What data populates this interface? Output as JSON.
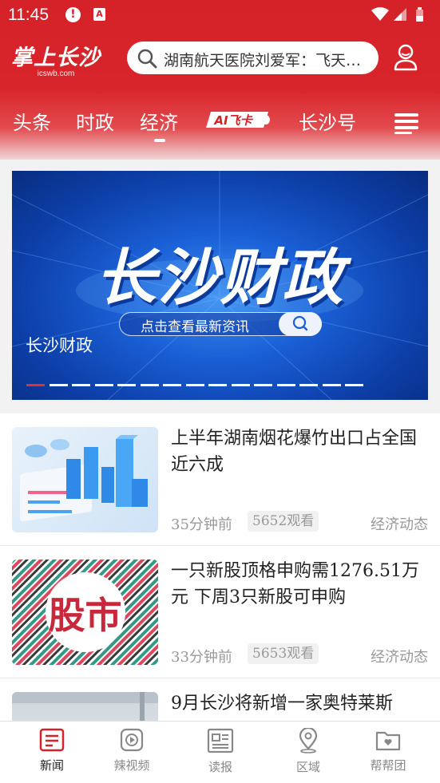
{
  "status_bar": {
    "time": "11:45",
    "icon_alert": "!",
    "icon_a": "A"
  },
  "header": {
    "logo_text": "掌上长沙",
    "logo_domain": "icswb.com",
    "search_text": "湖南航天医院刘爱军：飞天护航",
    "tabs": [
      "头条",
      "时政",
      "经济",
      "长沙号"
    ],
    "active_tab": "经济",
    "ai_tab_label": "AI飞卡"
  },
  "banner": {
    "title": "长沙财政",
    "search_label": "点击查看最新资讯",
    "caption": "长沙财政",
    "dot_count": 15,
    "active_dot": 0
  },
  "feed": [
    {
      "title": "上半年湖南烟花爆竹出口占全国近六成",
      "time": "35分钟前",
      "views": "5652观看",
      "category": "经济动态"
    },
    {
      "title": "一只新股顶格申购需1276.51万元  下周3只新股可申购",
      "time": "33分钟前",
      "views": "5653观看",
      "category": "经济动态",
      "thumb_text": "股市"
    },
    {
      "title": "9月长沙将新增一家奥特莱斯"
    }
  ],
  "bottom_nav": [
    {
      "label": "新闻",
      "icon": "news-icon",
      "active": true
    },
    {
      "label": "辣视频",
      "icon": "video-icon",
      "active": false
    },
    {
      "label": "读报",
      "icon": "newspaper-icon",
      "active": false
    },
    {
      "label": "区域",
      "icon": "location-icon",
      "active": false
    },
    {
      "label": "帮帮团",
      "icon": "folder-heart-icon",
      "active": false
    }
  ],
  "colors": {
    "brand_red": "#d42228",
    "banner_blue": "#1a5fd6"
  }
}
